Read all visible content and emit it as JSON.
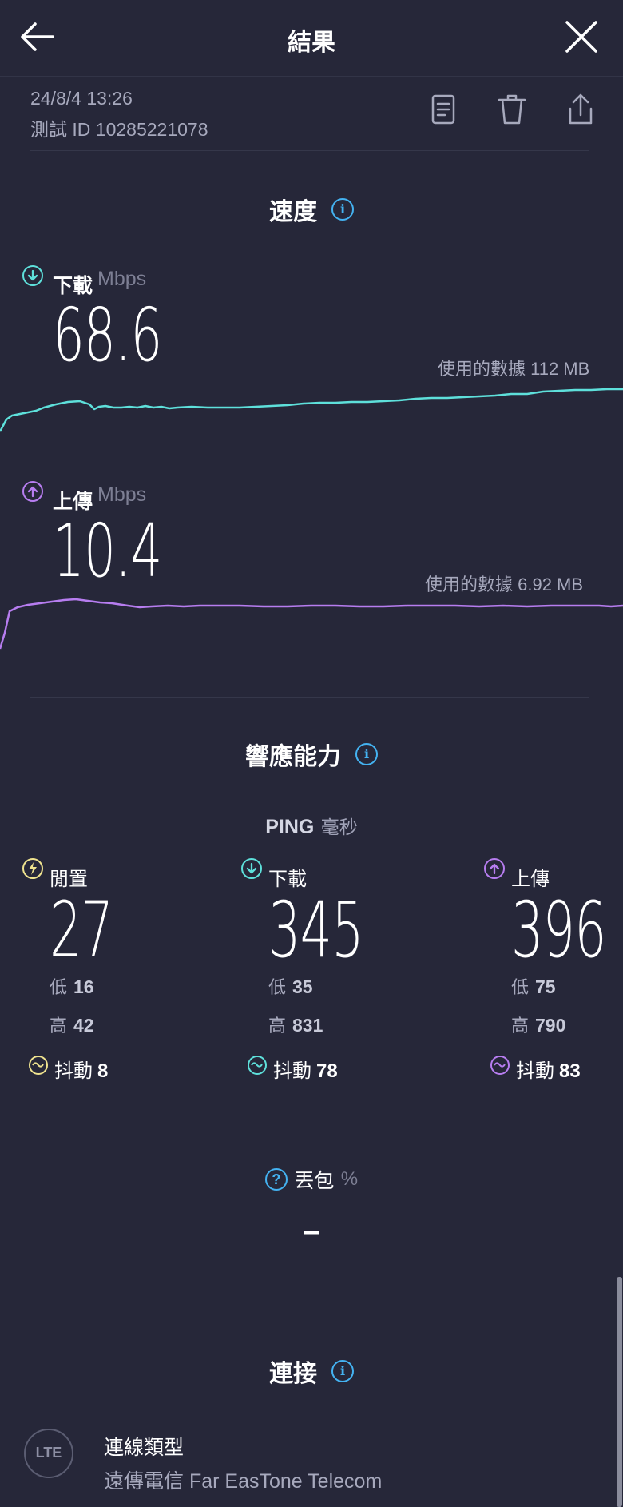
{
  "header": {
    "title": "結果"
  },
  "meta": {
    "datetime": "24/8/4 13:26",
    "test_id": "測試 ID 10285221078"
  },
  "speed": {
    "title": "速度",
    "download": {
      "label": "下載",
      "unit": "Mbps",
      "value": "68.6",
      "data_used": "使用的數據 112 MB"
    },
    "upload": {
      "label": "上傳",
      "unit": "Mbps",
      "value": "10.4",
      "data_used": "使用的數據 6.92 MB"
    }
  },
  "responsiveness": {
    "title": "響應能力",
    "ping_label": "PING",
    "ping_unit": "毫秒",
    "idle": {
      "label": "閒置",
      "value": "27",
      "low_label": "低",
      "low": "16",
      "high_label": "高",
      "high": "42",
      "jitter_label": "抖動",
      "jitter": "8"
    },
    "download": {
      "label": "下載",
      "value": "345",
      "low_label": "低",
      "low": "35",
      "high_label": "高",
      "high": "831",
      "jitter_label": "抖動",
      "jitter": "78"
    },
    "upload": {
      "label": "上傳",
      "value": "396",
      "low_label": "低",
      "low": "75",
      "high_label": "高",
      "high": "790",
      "jitter_label": "抖動",
      "jitter": "83"
    },
    "packet_loss": {
      "label": "丟包",
      "unit": "%",
      "value": "–"
    }
  },
  "connection": {
    "title": "連接",
    "badge": "LTE",
    "type_label": "連線類型",
    "provider": "遠傳電信 Far EasTone Telecom"
  },
  "colors": {
    "background": "#262739",
    "download": "#5ee0db",
    "upload": "#b77df0",
    "idle": "#efe38f",
    "info": "#44b3f2"
  }
}
